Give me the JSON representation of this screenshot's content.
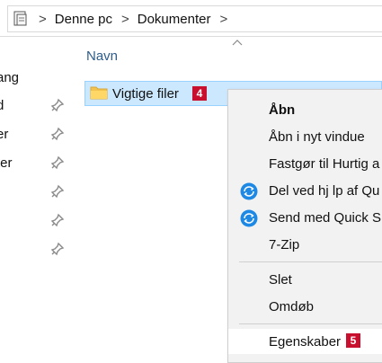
{
  "address": {
    "crumbs": [
      "Denne pc",
      "Dokumenter"
    ],
    "separator": ">"
  },
  "sidebar": {
    "items": [
      {
        "label": "ang",
        "pinned": false
      },
      {
        "label": "d",
        "pinned": true
      },
      {
        "label": "er",
        "pinned": true
      },
      {
        "label": "ter",
        "pinned": true
      },
      {
        "label": "",
        "pinned": true
      },
      {
        "label": "",
        "pinned": true
      },
      {
        "label": "",
        "pinned": true
      }
    ]
  },
  "list": {
    "column_header": "Navn",
    "selected_item": {
      "name": "Vigtige filer",
      "badge": "4"
    }
  },
  "context_menu": {
    "items": [
      {
        "label": "Åbn",
        "bold": true
      },
      {
        "label": "Åbn i nyt vindue"
      },
      {
        "label": "Fastgør til Hurtig a"
      },
      {
        "label": "Del ved hj lp af Qu",
        "icon": "quick-share-icon"
      },
      {
        "label": "Send med Quick S",
        "icon": "quick-share-icon"
      },
      {
        "label": "7-Zip"
      },
      {
        "label": "Slet"
      },
      {
        "label": "Omdøb"
      },
      {
        "label": "Egenskaber",
        "badge": "5",
        "highlighted": true
      }
    ]
  },
  "colors": {
    "selection": "#cce8ff",
    "badge": "#c8102e",
    "link": "#2f5d8a",
    "quick_share_blue": "#1e88e5"
  }
}
